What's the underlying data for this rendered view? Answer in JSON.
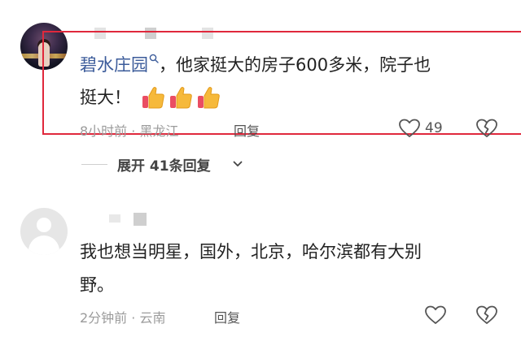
{
  "comments": [
    {
      "author": "碧水庄园",
      "text_line1": "，他家挺大的房子600多米，院子也",
      "text_line2": "挺大！",
      "emoji": [
        "thumbs-up",
        "thumbs-up",
        "thumbs-up"
      ],
      "meta": "8小时前 · 黑龙江",
      "reply_label": "回复",
      "like_count": "49"
    },
    {
      "text_line1": "我也想当明星，国外，北京，哈尔滨都有大别",
      "text_line2": "野。",
      "meta": "2分钟前 · 云南",
      "reply_label": "回复"
    }
  ],
  "expand": {
    "label": "展开 41条回复"
  },
  "icons": {
    "like": "heart-outline-icon",
    "dislike": "broken-heart-icon",
    "search": "search-icon",
    "expand": "chevron-down-icon"
  },
  "colors": {
    "author_link": "#3b5b9a",
    "highlight_border": "#e0283c",
    "thumb": "#f6b93b"
  }
}
